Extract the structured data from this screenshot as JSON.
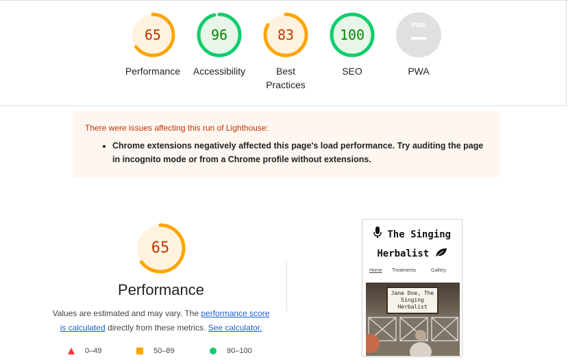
{
  "scores": [
    {
      "label": "Performance",
      "value": "65",
      "score": 0.65,
      "color": "#e67700",
      "track": "#fff3e0",
      "ring": "#ffa400"
    },
    {
      "label": "Accessibility",
      "value": "96",
      "score": 0.96,
      "color": "#008800",
      "track": "#e8f5e9",
      "ring": "#0cce6b"
    },
    {
      "label": "Best Practices",
      "value": "83",
      "score": 0.83,
      "color": "#e67700",
      "track": "#fff3e0",
      "ring": "#ffa400"
    },
    {
      "label": "SEO",
      "value": "100",
      "score": 1.0,
      "color": "#008800",
      "track": "#e8f5e9",
      "ring": "#0cce6b"
    },
    {
      "label": "PWA",
      "badge_text": "PWA"
    }
  ],
  "warning": {
    "title": "There were issues affecting this run of Lighthouse:",
    "items": [
      "Chrome extensions negatively affected this page's load performance. Try auditing the page in incognito mode or from a Chrome profile without extensions."
    ]
  },
  "performance": {
    "value": "65",
    "score": 0.65,
    "title": "Performance",
    "desc_prefix": "Values are estimated and may vary. The ",
    "desc_link1": "performance score is calculated",
    "desc_middle": " directly from these metrics. ",
    "desc_link2": "See calculator."
  },
  "legend": [
    {
      "shape": "triangle",
      "color": "#ff3333",
      "label": "0–49"
    },
    {
      "shape": "square",
      "color": "#ffa400",
      "label": "50–89"
    },
    {
      "shape": "circle",
      "color": "#0cce6b",
      "label": "90–100"
    }
  ],
  "thumbnail": {
    "title_line1": "The Singing",
    "title_line2": "Herbalist",
    "nav": [
      "Home",
      "Treatments",
      "Gallery"
    ],
    "sign": [
      "Jane Doe, The",
      "Singing",
      "Herbalist"
    ]
  }
}
